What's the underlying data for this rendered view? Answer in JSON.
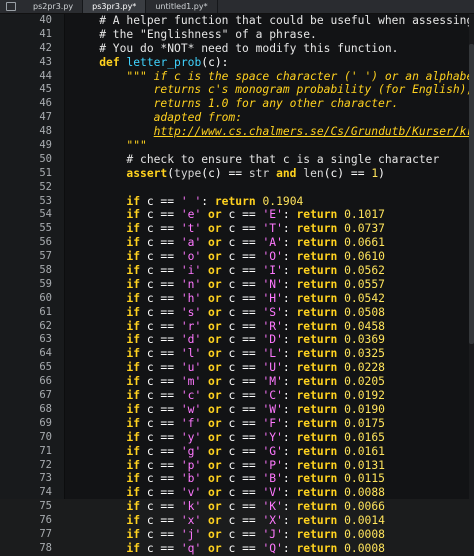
{
  "tabs": [
    {
      "label": "ps2pr3.py",
      "active": false
    },
    {
      "label": "ps3pr3.py*",
      "active": true
    },
    {
      "label": "untitled1.py*",
      "active": false
    }
  ],
  "header_lines": [
    {
      "n": 40,
      "text": "    # A helper function that could be useful when assessing"
    },
    {
      "n": 41,
      "text": "    # the \"Englishness\" of a phrase."
    },
    {
      "n": 42,
      "text": "    # You do *NOT* need to modify this function."
    },
    {
      "n": 43,
      "kw": "def ",
      "name": "letter_prob",
      "rest": "(c):"
    },
    {
      "n": 44,
      "text": "        \"\"\" if c is the space character (' ') or an alphabetic chara"
    },
    {
      "n": 45,
      "text": "            returns c's monogram probability (for English);"
    },
    {
      "n": 46,
      "text": "            returns 1.0 for any other character."
    },
    {
      "n": 47,
      "text": "            adapted from:"
    },
    {
      "n": 48,
      "text": "            http://www.cs.chalmers.se/Cs/Grundutb/Kurser/krypto/en_s"
    },
    {
      "n": 49,
      "text": "        \"\"\""
    },
    {
      "n": 50,
      "text": "        # check to ensure that c is a single character"
    },
    {
      "n": 51,
      "text": "        assert(type(c) == str and len(c) == 1)"
    },
    {
      "n": 52,
      "text": ""
    },
    {
      "n": 53,
      "text": "        if c == ' ': return 0.1904"
    }
  ],
  "prob_lines": [
    {
      "n": 54,
      "lower": "e",
      "upper": "E",
      "value": "0.1017"
    },
    {
      "n": 55,
      "lower": "t",
      "upper": "T",
      "value": "0.0737"
    },
    {
      "n": 56,
      "lower": "a",
      "upper": "A",
      "value": "0.0661"
    },
    {
      "n": 57,
      "lower": "o",
      "upper": "O",
      "value": "0.0610"
    },
    {
      "n": 58,
      "lower": "i",
      "upper": "I",
      "value": "0.0562"
    },
    {
      "n": 59,
      "lower": "n",
      "upper": "N",
      "value": "0.0557"
    },
    {
      "n": 60,
      "lower": "h",
      "upper": "H",
      "value": "0.0542"
    },
    {
      "n": 61,
      "lower": "s",
      "upper": "S",
      "value": "0.0508"
    },
    {
      "n": 62,
      "lower": "r",
      "upper": "R",
      "value": "0.0458"
    },
    {
      "n": 63,
      "lower": "d",
      "upper": "D",
      "value": "0.0369"
    },
    {
      "n": 64,
      "lower": "l",
      "upper": "L",
      "value": "0.0325"
    },
    {
      "n": 65,
      "lower": "u",
      "upper": "U",
      "value": "0.0228"
    },
    {
      "n": 66,
      "lower": "m",
      "upper": "M",
      "value": "0.0205"
    },
    {
      "n": 67,
      "lower": "c",
      "upper": "C",
      "value": "0.0192"
    },
    {
      "n": 68,
      "lower": "w",
      "upper": "W",
      "value": "0.0190"
    },
    {
      "n": 69,
      "lower": "f",
      "upper": "F",
      "value": "0.0175"
    },
    {
      "n": 70,
      "lower": "y",
      "upper": "Y",
      "value": "0.0165"
    },
    {
      "n": 71,
      "lower": "g",
      "upper": "G",
      "value": "0.0161"
    },
    {
      "n": 72,
      "lower": "p",
      "upper": "P",
      "value": "0.0131"
    },
    {
      "n": 73,
      "lower": "b",
      "upper": "B",
      "value": "0.0115"
    },
    {
      "n": 74,
      "lower": "v",
      "upper": "V",
      "value": "0.0088"
    },
    {
      "n": 75,
      "lower": "k",
      "upper": "K",
      "value": "0.0066"
    },
    {
      "n": 76,
      "lower": "x",
      "upper": "X",
      "value": "0.0014"
    },
    {
      "n": 77,
      "lower": "j",
      "upper": "J",
      "value": "0.0008"
    },
    {
      "n": 78,
      "lower": "q",
      "upper": "Q",
      "value": "0.0008"
    }
  ],
  "colors": {
    "background": "#121315",
    "keyword": "#ffd21f",
    "string": "#ff78ff",
    "function_name": "#40d4ff",
    "number": "#ffe45c"
  }
}
